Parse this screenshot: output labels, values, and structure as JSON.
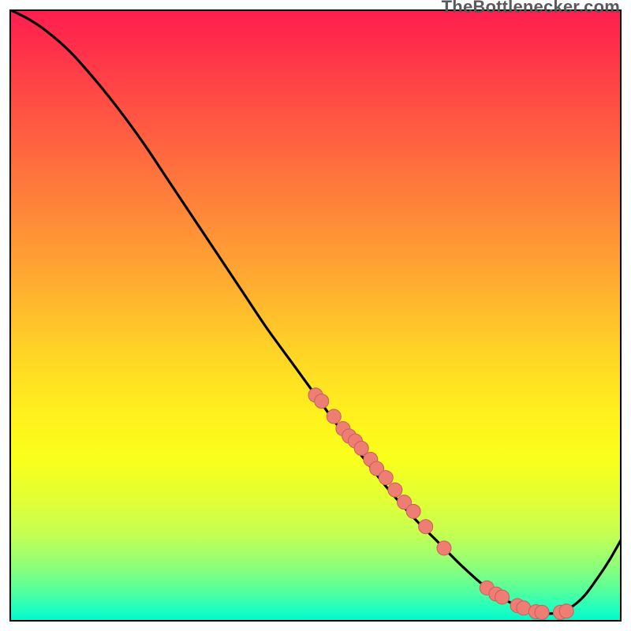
{
  "attribution": "TheBottlenecker.com",
  "colors": {
    "curve": "#000000",
    "marker_fill": "#ee7d74",
    "marker_stroke": "#c85f5a",
    "frame": "#000000"
  },
  "chart_data": {
    "type": "line",
    "title": "",
    "xlabel": "",
    "ylabel": "",
    "xlim": [
      0,
      100
    ],
    "ylim": [
      0,
      100
    ],
    "grid": false,
    "legend": false,
    "series": [
      {
        "name": "bottleneck-curve",
        "x": [
          0,
          3,
          6,
          10,
          14,
          18,
          22,
          26,
          30,
          34,
          38,
          42,
          46,
          50,
          54,
          58,
          62,
          66,
          70,
          74,
          78,
          82,
          84,
          86,
          88,
          90,
          92,
          94,
          96,
          98,
          100
        ],
        "y": [
          100,
          98.5,
          96.5,
          93,
          88.5,
          83.5,
          78,
          72,
          66,
          60,
          54,
          48,
          42.5,
          37,
          31.5,
          26.5,
          21.5,
          17,
          13,
          9,
          5.5,
          3,
          2.2,
          1.6,
          1.3,
          1.5,
          2.5,
          4.3,
          7.0,
          10,
          13.5
        ]
      }
    ],
    "markers": {
      "name": "data-points",
      "x": [
        50,
        51,
        53,
        54.5,
        55.5,
        56.5,
        57.5,
        59,
        60,
        61.5,
        63,
        64.5,
        66,
        68,
        71,
        78,
        79.5,
        80.5,
        83,
        84,
        86,
        87,
        90,
        91
      ],
      "y": [
        37,
        36,
        33.5,
        31.5,
        30.3,
        29.5,
        28.3,
        26.5,
        25,
        23.5,
        21.5,
        19.5,
        18,
        15.5,
        12,
        5.5,
        4.5,
        4,
        2.6,
        2.2,
        1.6,
        1.5,
        1.5,
        1.7
      ]
    }
  }
}
